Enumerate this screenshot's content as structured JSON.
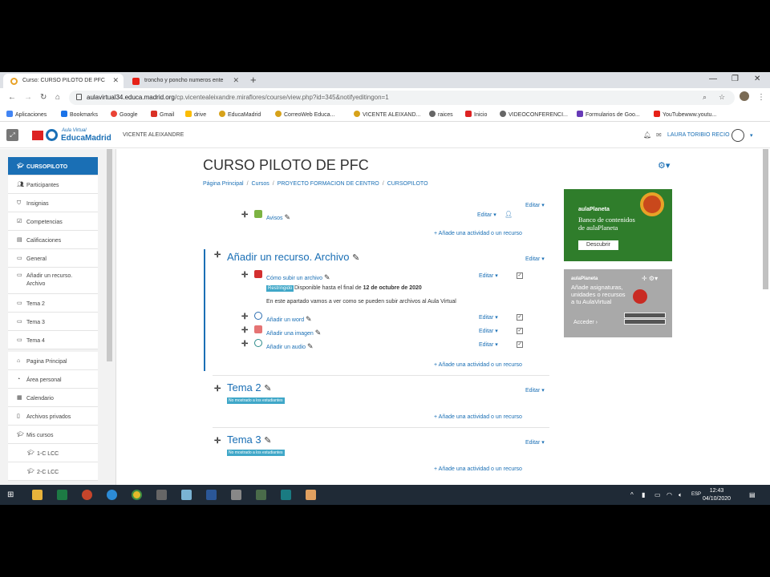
{
  "browser": {
    "tabs": [
      {
        "title": "Curso: CURSO PILOTO DE PFC",
        "active": true
      },
      {
        "title": "troncho y poncho numeros ente",
        "active": false
      }
    ],
    "url_host": "aulavirtual34.educa.madrid.org",
    "url_path": "/cp.vicentealeixandre.miraflores/course/view.php?id=345&notifyeditingon=1",
    "bookmarks": [
      "Aplicaciones",
      "Bookmarks",
      "Google",
      "Gmail",
      "drive",
      "EducaMadrid",
      "CorreoWeb Educa...",
      "VICENTE ALEIXAND...",
      "raices",
      "Inicio",
      "VIDEOCONFERENCI...",
      "Formularios de Goo...",
      "YouTubewww.youtu..."
    ]
  },
  "header": {
    "logo_small": "Aula Virtual",
    "logo_big": "EducaMadrid",
    "school": "VICENTE ALEIXANDRE",
    "user": "LAURA TORIBIO RECIO"
  },
  "drawer": {
    "items": [
      {
        "label": "CURSOPILOTO",
        "icon": "graduation-cap-icon"
      },
      {
        "label": "Participantes",
        "icon": "users-icon"
      },
      {
        "label": "Insignias",
        "icon": "badge-icon"
      },
      {
        "label": "Competencias",
        "icon": "check-square-icon"
      },
      {
        "label": "Calificaciones",
        "icon": "table-icon"
      },
      {
        "label": "General",
        "icon": "folder-icon"
      },
      {
        "label": "Añadir un recurso. Archivo",
        "icon": "folder-icon"
      },
      {
        "label": "Tema 2",
        "icon": "folder-icon"
      },
      {
        "label": "Tema 3",
        "icon": "folder-icon"
      },
      {
        "label": "Tema 4",
        "icon": "folder-icon"
      },
      {
        "label": "Pagina Principal",
        "icon": "home-icon"
      },
      {
        "label": "Área personal",
        "icon": "dashboard-icon"
      },
      {
        "label": "Calendario",
        "icon": "calendar-icon"
      },
      {
        "label": "Archivos privados",
        "icon": "file-icon"
      },
      {
        "label": "Mis cursos",
        "icon": "graduation-cap-icon"
      },
      {
        "label": "1-C LCC",
        "icon": "graduation-cap-icon"
      },
      {
        "label": "2-C LCC",
        "icon": "graduation-cap-icon"
      }
    ]
  },
  "course": {
    "title": "CURSO PILOTO DE PFC",
    "breadcrumb": [
      "Página Principal",
      "Cursos",
      "PROYECTO FORMACION DE CENTRO",
      "CURSOPILOTO"
    ],
    "edit_label": "Editar",
    "add_activity": "Añade una actividad o un recurso",
    "general": {
      "activities": [
        {
          "name": "Avisos"
        }
      ]
    },
    "section_archivo": {
      "title": "Añadir un recurso. Archivo",
      "activities": [
        {
          "name": "Cómo subir un archivo"
        },
        {
          "name": "Añadir un word"
        },
        {
          "name": "Añadir una imagen"
        },
        {
          "name": "Añadir un audio"
        }
      ],
      "restricted_badge": "Restringido",
      "availability_text": "Disponible hasta el final de",
      "availability_date": "12 de octubre de 2020",
      "description": "En este apartado vamos a ver como se pueden subir archivos al Aula Virtual"
    },
    "tema2": {
      "title": "Tema 2",
      "hidden_badge": "No mostrado a los estudiantes"
    },
    "tema3": {
      "title": "Tema 3",
      "hidden_badge": "No mostrado a los estudiantes"
    }
  },
  "promos": {
    "p1_brand": "aulaPlaneta",
    "p1_text": "Banco de contenidos de aulaPlaneta",
    "p1_button": "Descubrir",
    "p2_brand": "aulaPlaneta",
    "p2_text": "Añade asignaturas, unidades o recursos a tu AulaVirtual",
    "p2_button": "Acceder"
  },
  "taskbar": {
    "time": "12:43",
    "date": "04/10/2020",
    "lang": "ESP"
  },
  "colors": {
    "accent": "#1a6fb5",
    "badge": "#3fa7c8"
  }
}
